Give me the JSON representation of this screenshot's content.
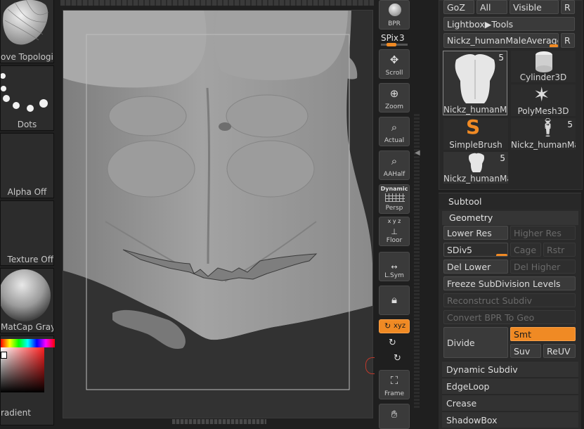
{
  "shelf": {
    "tiles": [
      {
        "label": "ove Topological"
      },
      {
        "label": "Dots"
      },
      {
        "label": "Alpha Off"
      },
      {
        "label": "Texture Off"
      },
      {
        "label": "MatCap Gray"
      },
      {
        "label": "radient"
      }
    ]
  },
  "toolbar": {
    "bpr": "BPR",
    "spix_label": "SPix",
    "spix_value": "3",
    "spix_level": 0.3,
    "buttons": [
      {
        "label": "Scroll"
      },
      {
        "label": "Zoom"
      },
      {
        "label": "Actual"
      },
      {
        "label": "AAHalf"
      },
      {
        "label": "Persp",
        "top": "Dynamic"
      },
      {
        "label": "Floor",
        "top": "x y z"
      },
      {
        "label": "L.Sym"
      },
      {
        "label": ""
      },
      {
        "label": "xyz"
      },
      {
        "label": "Frame"
      }
    ]
  },
  "tool_palette": {
    "top_buttons": [
      "GoZ",
      "All",
      "Visible",
      "R"
    ],
    "lightbox_tools": "Lightbox▶Tools",
    "current_tool": "Nickz_humanMaleAverage_",
    "current_tool_r": "R",
    "current_tool_level": 0.9,
    "thumbs": [
      {
        "label": "Nickz_humanMa",
        "count": "5"
      },
      {
        "label": "Cylinder3D",
        "count": ""
      },
      {
        "label": "PolyMesh3D",
        "count": ""
      },
      {
        "label": "SimpleBrush",
        "count": ""
      },
      {
        "label": "Nickz_humanMa",
        "count": "5"
      },
      {
        "label": "Nickz_humanMa",
        "count": "5"
      }
    ],
    "subtool": "Subtool",
    "geometry": "Geometry",
    "lower_res": "Lower Res",
    "higher_res": "Higher Res",
    "sdiv_label": "SDiv",
    "sdiv_value": "5",
    "sdiv_level": 0.9,
    "cage": "Cage",
    "rstr": "Rstr",
    "del_lower": "Del Lower",
    "del_higher": "Del Higher",
    "freeze": "Freeze SubDivision Levels",
    "reconstruct": "Reconstruct Subdiv",
    "convert_bpr": "Convert BPR To Geo",
    "divide": "Divide",
    "smt": "Smt",
    "suv": "Suv",
    "reuv": "ReUV",
    "dynamic_subdiv": "Dynamic Subdiv",
    "edgeloop": "EdgeLoop",
    "crease": "Crease",
    "shadowbox": "ShadowBox"
  },
  "colors": {
    "accent": "#f08a24",
    "panel": "#323232",
    "background": "#1f1f1f"
  }
}
